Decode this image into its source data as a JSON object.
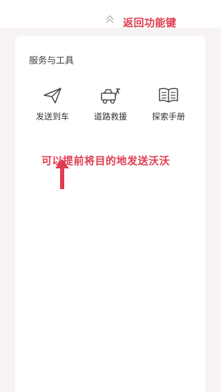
{
  "header": {
    "back_annotation": "返回功能键",
    "back_icon": "double-chevron-up-icon"
  },
  "services": {
    "title": "服务与工具",
    "items": [
      {
        "label": "发送到车",
        "icon": "paper-plane-icon"
      },
      {
        "label": "道路救援",
        "icon": "tow-truck-icon"
      },
      {
        "label": "探索手册",
        "icon": "open-book-icon"
      }
    ]
  },
  "annotations": {
    "send_note": "可以提前将目的地发送沃沃",
    "arrow_icon": "red-up-arrow-icon"
  },
  "colors": {
    "annotation": "#e03c4f",
    "background": "#f7f3f5",
    "card": "#ffffff",
    "icon_stroke": "#444444"
  }
}
